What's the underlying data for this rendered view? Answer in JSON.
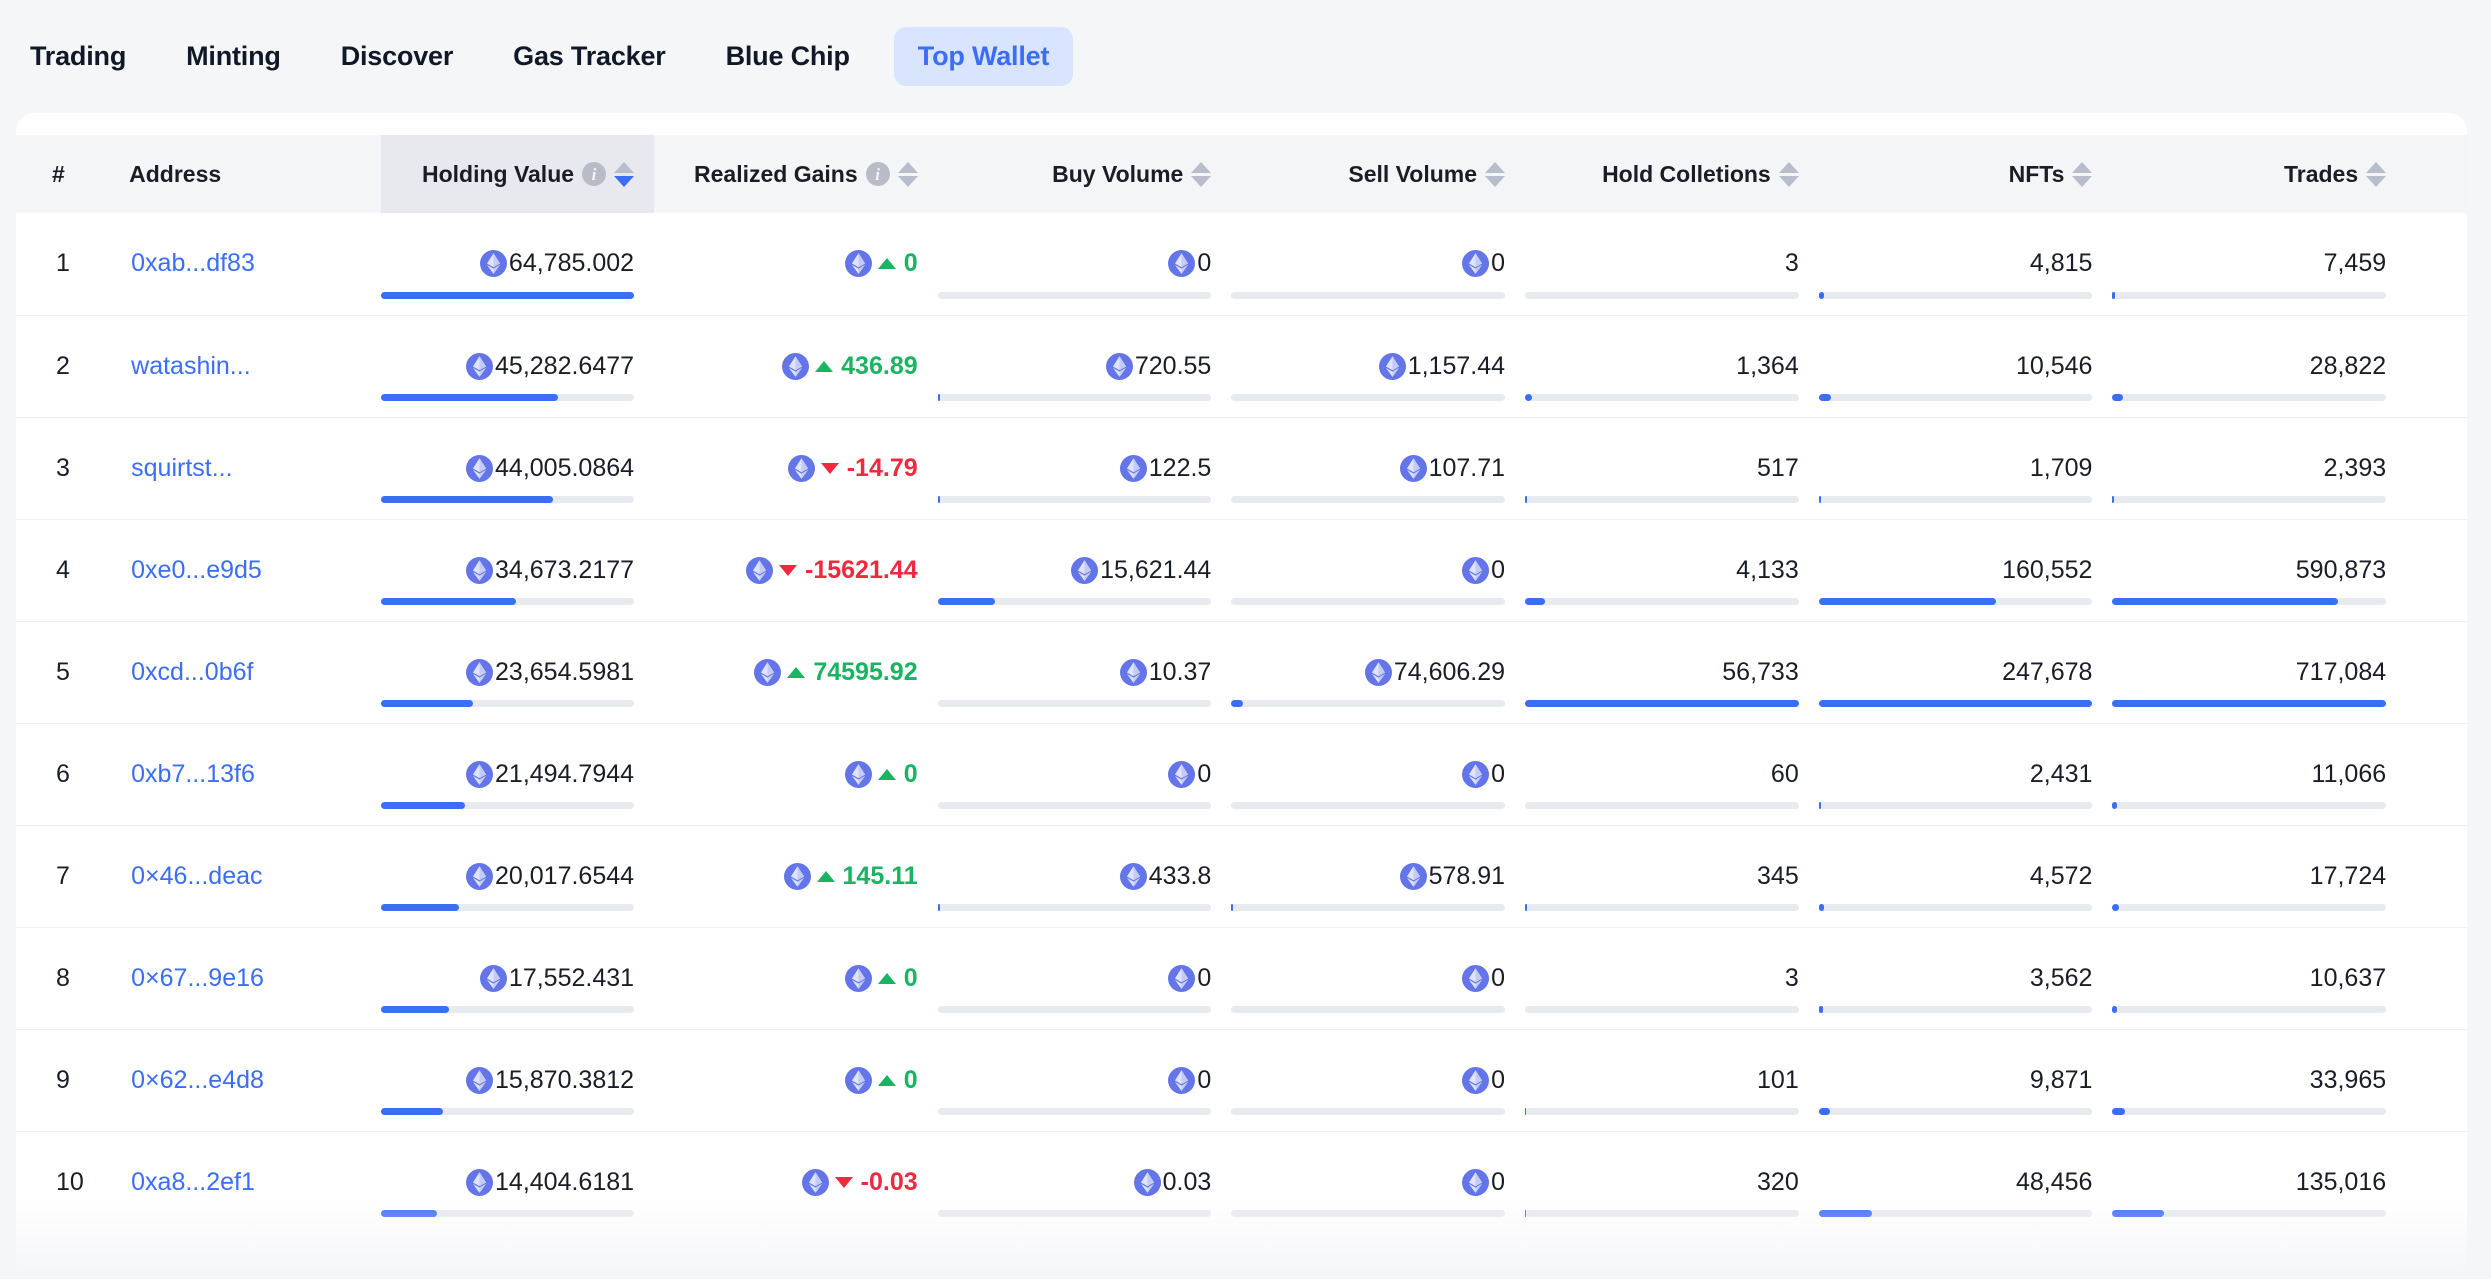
{
  "nav": {
    "tabs": [
      {
        "label": "Trading",
        "active": false
      },
      {
        "label": "Minting",
        "active": false
      },
      {
        "label": "Discover",
        "active": false
      },
      {
        "label": "Gas Tracker",
        "active": false
      },
      {
        "label": "Blue Chip",
        "active": false
      },
      {
        "label": "Top Wallet",
        "active": true
      }
    ]
  },
  "colors": {
    "accent": "#3b6ef6",
    "active_tab_bg": "#d9e4ff",
    "positive": "#18b461",
    "negative": "#f0293e",
    "eth_badge": "#6375e8",
    "bar_track": "#e7eaee",
    "header_bg": "#f4f5f7",
    "header_sorted_bg": "#e7e9ee",
    "page_bg": "#f5f6f8"
  },
  "table": {
    "columns": [
      {
        "key": "rank",
        "label": "#",
        "align": "left",
        "info": false,
        "sort": "none",
        "sorted": false
      },
      {
        "key": "addr",
        "label": "Address",
        "align": "left",
        "info": false,
        "sort": "none",
        "sorted": false
      },
      {
        "key": "hold",
        "label": "Holding Value",
        "align": "right",
        "info": true,
        "sort": "desc",
        "sorted": true
      },
      {
        "key": "gain",
        "label": "Realized Gains",
        "align": "right",
        "info": true,
        "sort": "none",
        "sorted": false
      },
      {
        "key": "buy",
        "label": "Buy Volume",
        "align": "right",
        "info": false,
        "sort": "none",
        "sorted": false
      },
      {
        "key": "sell",
        "label": "Sell Volume",
        "align": "right",
        "info": false,
        "sort": "none",
        "sorted": false
      },
      {
        "key": "coll",
        "label": "Hold Colletions",
        "align": "right",
        "info": false,
        "sort": "none",
        "sorted": false
      },
      {
        "key": "nfts",
        "label": "NFTs",
        "align": "right",
        "info": false,
        "sort": "none",
        "sorted": false
      },
      {
        "key": "trade",
        "label": "Trades",
        "align": "right",
        "info": false,
        "sort": "none",
        "sorted": false
      }
    ],
    "icons": {
      "info": "info-icon",
      "sort": "sort-arrows-icon",
      "currency": "ethereum-icon"
    },
    "rows": [
      {
        "rank": "1",
        "address": "0xab...df83",
        "holding": {
          "value": "64,785.002",
          "eth": true,
          "pct": 100
        },
        "gains": {
          "value": "0",
          "eth": true,
          "dir": "up",
          "pct": 0
        },
        "buy": {
          "value": "0",
          "eth": true,
          "pct": 0
        },
        "sell": {
          "value": "0",
          "eth": true,
          "pct": 0
        },
        "collections": {
          "value": "3",
          "eth": false,
          "pct": 0
        },
        "nfts": {
          "value": "4,815",
          "eth": false,
          "pct": 1.9
        },
        "trades": {
          "value": "7,459",
          "eth": false,
          "pct": 1
        }
      },
      {
        "rank": "2",
        "address": "watashin...",
        "holding": {
          "value": "45,282.6477",
          "eth": true,
          "pct": 69.9
        },
        "gains": {
          "value": "436.89",
          "eth": true,
          "dir": "up",
          "pct": 0
        },
        "buy": {
          "value": "720.55",
          "eth": true,
          "pct": 1
        },
        "sell": {
          "value": "1,157.44",
          "eth": true,
          "pct": 0
        },
        "collections": {
          "value": "1,364",
          "eth": false,
          "pct": 2.4
        },
        "nfts": {
          "value": "10,546",
          "eth": false,
          "pct": 4.3
        },
        "trades": {
          "value": "28,822",
          "eth": false,
          "pct": 4
        }
      },
      {
        "rank": "3",
        "address": "squirtst...",
        "holding": {
          "value": "44,005.0864",
          "eth": true,
          "pct": 67.9
        },
        "gains": {
          "value": "-14.79",
          "eth": true,
          "dir": "down",
          "pct": 0
        },
        "buy": {
          "value": "122.5",
          "eth": true,
          "pct": 0.8
        },
        "sell": {
          "value": "107.71",
          "eth": true,
          "pct": 0
        },
        "collections": {
          "value": "517",
          "eth": false,
          "pct": 0.9
        },
        "nfts": {
          "value": "1,709",
          "eth": false,
          "pct": 0.7
        },
        "trades": {
          "value": "2,393",
          "eth": false,
          "pct": 0.4
        }
      },
      {
        "rank": "4",
        "address": "0xe0...e9d5",
        "holding": {
          "value": "34,673.2177",
          "eth": true,
          "pct": 53.5
        },
        "gains": {
          "value": "-15621.44",
          "eth": true,
          "dir": "down",
          "pct": 0
        },
        "buy": {
          "value": "15,621.44",
          "eth": true,
          "pct": 20.9
        },
        "sell": {
          "value": "0",
          "eth": true,
          "pct": 0
        },
        "collections": {
          "value": "4,133",
          "eth": false,
          "pct": 7.3
        },
        "nfts": {
          "value": "160,552",
          "eth": false,
          "pct": 64.8
        },
        "trades": {
          "value": "590,873",
          "eth": false,
          "pct": 82.4
        }
      },
      {
        "rank": "5",
        "address": "0xcd...0b6f",
        "holding": {
          "value": "23,654.5981",
          "eth": true,
          "pct": 36.5
        },
        "gains": {
          "value": "74595.92",
          "eth": true,
          "dir": "up",
          "pct": 0
        },
        "buy": {
          "value": "10.37",
          "eth": true,
          "pct": 0
        },
        "sell": {
          "value": "74,606.29",
          "eth": true,
          "pct": 4.2
        },
        "collections": {
          "value": "56,733",
          "eth": false,
          "pct": 100
        },
        "nfts": {
          "value": "247,678",
          "eth": false,
          "pct": 100
        },
        "trades": {
          "value": "717,084",
          "eth": false,
          "pct": 100
        }
      },
      {
        "rank": "6",
        "address": "0xb7...13f6",
        "holding": {
          "value": "21,494.7944",
          "eth": true,
          "pct": 33.2
        },
        "gains": {
          "value": "0",
          "eth": true,
          "dir": "up",
          "pct": 0
        },
        "buy": {
          "value": "0",
          "eth": true,
          "pct": 0
        },
        "sell": {
          "value": "0",
          "eth": true,
          "pct": 0
        },
        "collections": {
          "value": "60",
          "eth": false,
          "pct": 0
        },
        "nfts": {
          "value": "2,431",
          "eth": false,
          "pct": 1
        },
        "trades": {
          "value": "11,066",
          "eth": false,
          "pct": 1.5
        }
      },
      {
        "rank": "7",
        "address": "0×46...deac",
        "holding": {
          "value": "20,017.6544",
          "eth": true,
          "pct": 30.9
        },
        "gains": {
          "value": "145.11",
          "eth": true,
          "dir": "up",
          "pct": 0
        },
        "buy": {
          "value": "433.8",
          "eth": true,
          "pct": 0.8
        },
        "sell": {
          "value": "578.91",
          "eth": true,
          "pct": 0.6
        },
        "collections": {
          "value": "345",
          "eth": false,
          "pct": 0.6
        },
        "nfts": {
          "value": "4,572",
          "eth": false,
          "pct": 1.8
        },
        "trades": {
          "value": "17,724",
          "eth": false,
          "pct": 2.5
        }
      },
      {
        "rank": "8",
        "address": "0×67...9e16",
        "holding": {
          "value": "17,552.431",
          "eth": true,
          "pct": 27.1
        },
        "gains": {
          "value": "0",
          "eth": true,
          "dir": "up",
          "pct": 0
        },
        "buy": {
          "value": "0",
          "eth": true,
          "pct": 0
        },
        "sell": {
          "value": "0",
          "eth": true,
          "pct": 0
        },
        "collections": {
          "value": "3",
          "eth": false,
          "pct": 0
        },
        "nfts": {
          "value": "3,562",
          "eth": false,
          "pct": 1.4
        },
        "trades": {
          "value": "10,637",
          "eth": false,
          "pct": 1.5
        }
      },
      {
        "rank": "9",
        "address": "0×62...e4d8",
        "holding": {
          "value": "15,870.3812",
          "eth": true,
          "pct": 24.5
        },
        "gains": {
          "value": "0",
          "eth": true,
          "dir": "up",
          "pct": 0
        },
        "buy": {
          "value": "0",
          "eth": true,
          "pct": 0
        },
        "sell": {
          "value": "0",
          "eth": true,
          "pct": 0
        },
        "collections": {
          "value": "101",
          "eth": false,
          "pct": 0.3
        },
        "nfts": {
          "value": "9,871",
          "eth": false,
          "pct": 4
        },
        "trades": {
          "value": "33,965",
          "eth": false,
          "pct": 4.7
        }
      },
      {
        "rank": "10",
        "address": "0xa8...2ef1",
        "holding": {
          "value": "14,404.6181",
          "eth": true,
          "pct": 22.2
        },
        "gains": {
          "value": "-0.03",
          "eth": true,
          "dir": "down",
          "pct": 0
        },
        "buy": {
          "value": "0.03",
          "eth": true,
          "pct": 0
        },
        "sell": {
          "value": "0",
          "eth": true,
          "pct": 0
        },
        "collections": {
          "value": "320",
          "eth": false,
          "pct": 0.5
        },
        "nfts": {
          "value": "48,456",
          "eth": false,
          "pct": 19.6
        },
        "trades": {
          "value": "135,016",
          "eth": false,
          "pct": 18.8
        }
      }
    ]
  }
}
